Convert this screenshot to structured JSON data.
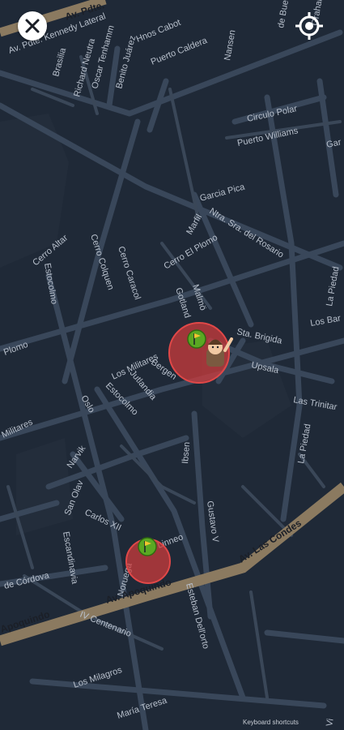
{
  "controls": {
    "close_icon": "close-icon",
    "locate_icon": "my-location-icon"
  },
  "map": {
    "style": "dark",
    "colors": {
      "background": "#1f2937",
      "road": "#39475a",
      "major_road": "#8b7a60",
      "zone_fill": "#d33b3b",
      "marker_fill": "#5aa823"
    }
  },
  "streets": [
    "Av. Pdte.",
    "Av. Pdte. Kennedy Lateral",
    "Oscar Tenhamm",
    "Benito Juárez",
    "Hnos Cabot",
    "Puerto Caldera",
    "Nansen",
    "Graham",
    "de Bueras",
    "Richard Neutra",
    "Brasilia",
    "Circulo Polar",
    "Puerto Williams",
    "Gar",
    "Garcia Pica",
    "Marfil",
    "Ntra. Sra. del Rosario",
    "Cerro Altar",
    "Cerro Colquen",
    "Cerro Caracol",
    "Cerro El Plomo",
    "Estocolmo",
    "Malmö",
    "Gotland",
    "La Piedad",
    "Los Bar",
    "Sta. Brigida",
    "Upsala",
    "Bergen",
    "Los Militares",
    "Jutlandia",
    "Plomo",
    "Militares",
    "Las Trinitar",
    "La Piedad",
    "Estocolmo",
    "Oslo",
    "Narvik",
    "San Olav",
    "Carlos XII",
    "Ibsen",
    "Gustavo V",
    "Escandinavia",
    "Noruega",
    "Linneo",
    "Av. Las Condes",
    "Av. Apoquindo",
    "Apoquindo",
    "de Córdova",
    "IV Centenario",
    "Esteban Dell'orto",
    "Los Milagros",
    "María Teresa",
    "Vi"
  ],
  "zones": [
    {
      "name": "zone-1",
      "marker": "flag-marker",
      "avatar": "character-avatar"
    },
    {
      "name": "zone-2",
      "marker": "flag-marker"
    }
  ],
  "attribution": "Keyboard shortcuts"
}
